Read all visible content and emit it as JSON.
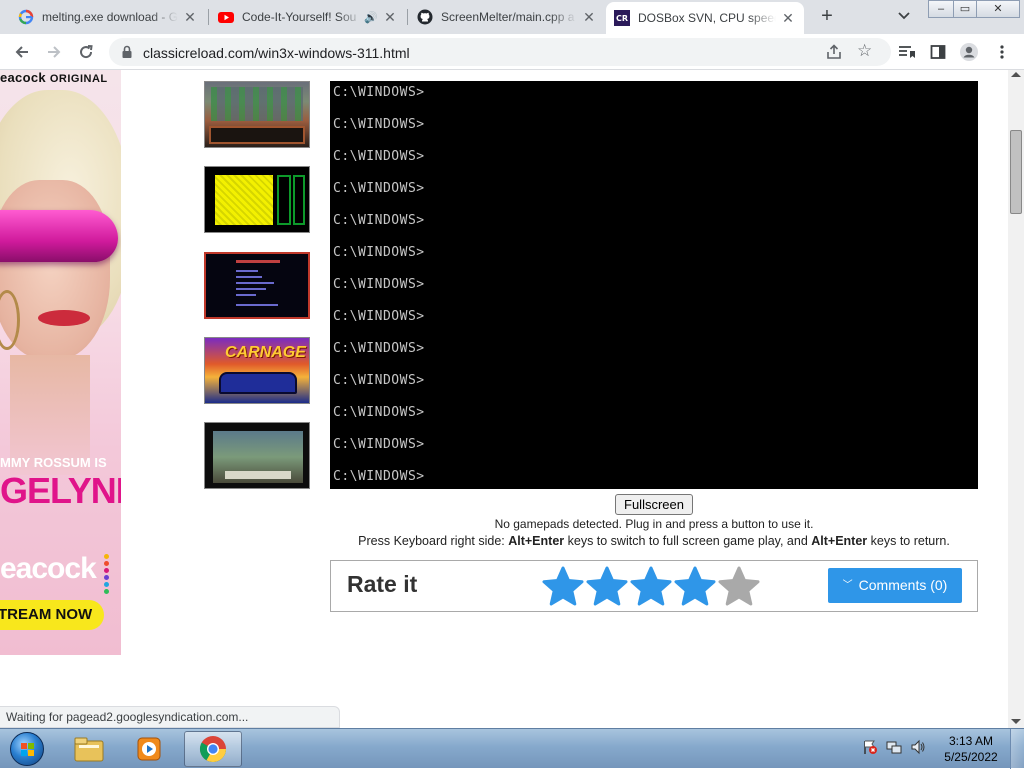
{
  "browser": {
    "tabs": [
      {
        "title": "melting.exe download - G",
        "favicon": "google-g-icon",
        "active": false
      },
      {
        "title": "Code-It-Yourself! Sou",
        "favicon": "youtube-icon",
        "active": false,
        "audio": "🔊"
      },
      {
        "title": "ScreenMelter/main.cpp a",
        "favicon": "github-icon",
        "active": false
      },
      {
        "title": "DOSBox SVN, CPU speed",
        "favicon": "classicreload-icon",
        "active": true
      }
    ],
    "new_tab": "+",
    "tab_search": "⌄",
    "window_controls": {
      "minimize": "–",
      "maximize": "▭",
      "close": "✕"
    },
    "url": "classicreload.com/win3x-windows-311.html",
    "status_text": "Waiting for pagead2.googlesyndication.com..."
  },
  "ad": {
    "brand": "eacock",
    "brand_suffix": "ORIGINAL",
    "star_name": "MMY ROSSUM IS",
    "show_title": "GELYNE",
    "network": "eacock",
    "cta": "TREAM NOW",
    "dot_colors": [
      "#f5b50a",
      "#ef4c2c",
      "#d61a79",
      "#6a3fd0",
      "#21a6e0",
      "#2ebd59"
    ]
  },
  "dos": {
    "lines": [
      "C:\\WINDOWS>",
      "C:\\WINDOWS>",
      "C:\\WINDOWS>",
      "C:\\WINDOWS>",
      "C:\\WINDOWS>",
      "C:\\WINDOWS>",
      "C:\\WINDOWS>",
      "C:\\WINDOWS>",
      "C:\\WINDOWS>",
      "C:\\WINDOWS>",
      "C:\\WINDOWS>",
      "C:\\WINDOWS>",
      "C:\\WINDOWS>"
    ]
  },
  "thumbnails": [
    {
      "art": "t1"
    },
    {
      "art": "t2"
    },
    {
      "art": "t3"
    },
    {
      "art": "t4",
      "logo": "CARNAGE"
    },
    {
      "art": "t5"
    }
  ],
  "player": {
    "fullscreen_label": "Fullscreen",
    "gamepad_note": "No gamepads detected. Plug in and press a button to use it.",
    "keyboard_pre": "Press Keyboard right side: ",
    "keyboard_key1": "Alt+Enter",
    "keyboard_mid": " keys to switch to full screen game play, and ",
    "keyboard_key2": "Alt+Enter",
    "keyboard_post": " keys to return."
  },
  "rating": {
    "label": "Rate it",
    "stars_total": 5,
    "stars_filled": 4,
    "filled_color": "#2f96e8",
    "empty_color": "#a9a9a9",
    "comments_label": "Comments (0)"
  },
  "taskbar": {
    "apps": [
      {
        "name": "explorer-icon",
        "active": false
      },
      {
        "name": "media-player-icon",
        "active": false
      },
      {
        "name": "chrome-icon",
        "active": true
      }
    ],
    "clock_time": "3:13 AM",
    "clock_date": "5/25/2022"
  }
}
